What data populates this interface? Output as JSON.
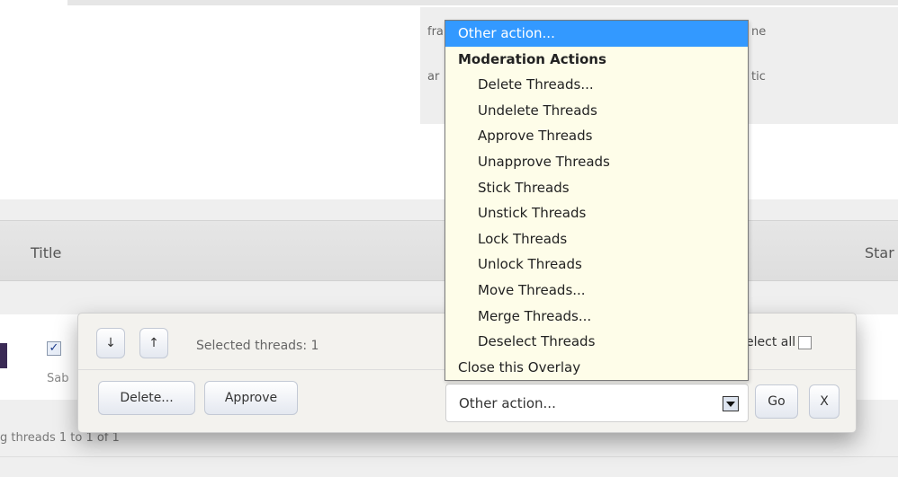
{
  "background_text": {
    "frag1": "fra",
    "frag2": "ne",
    "frag3": "ar",
    "frag4": "tic"
  },
  "table": {
    "col_title": "Title",
    "col_start": "Star",
    "row_checkbox_mark": "✓",
    "row_name": "Sab",
    "status": "g threads 1 to 1 of 1"
  },
  "overlay": {
    "move_down_label": "↓",
    "move_up_label": "↑",
    "selected_text": "Selected threads: 1",
    "select_all_label": "elect all",
    "delete_label": "Delete...",
    "approve_label": "Approve",
    "action_select_value": "Other action...",
    "go_label": "Go",
    "close_label": "X"
  },
  "dropdown": {
    "selected": "Other action...",
    "group_label": "Moderation Actions",
    "options": [
      "Delete Threads...",
      "Undelete Threads",
      "Approve Threads",
      "Unapprove Threads",
      "Stick Threads",
      "Unstick Threads",
      "Lock Threads",
      "Unlock Threads",
      "Move Threads...",
      "Merge Threads...",
      "Deselect Threads"
    ],
    "close_option": "Close this Overlay"
  },
  "colors": {
    "highlight": "#3399ff",
    "dropdown_bg": "#fefde9",
    "overlay_bg": "#f3f2ee"
  }
}
